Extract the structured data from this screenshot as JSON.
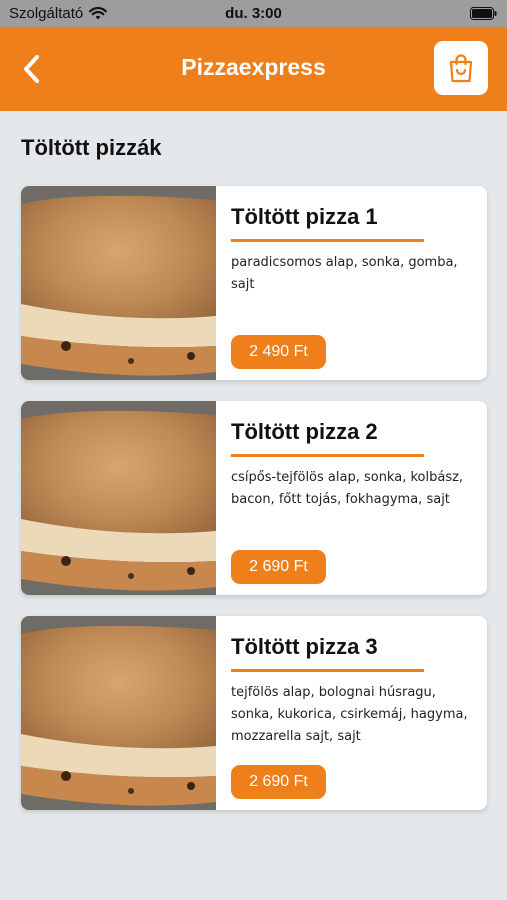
{
  "status_bar": {
    "carrier": "Szolgáltató",
    "time": "du. 3:00"
  },
  "header": {
    "title": "Pizzaexpress",
    "back_icon": "chevron-left-icon",
    "cart_icon": "shopping-bag-icon"
  },
  "section": {
    "title": "Töltött pizzák"
  },
  "products": [
    {
      "name": "Töltött pizza 1",
      "description": "paradicsomos alap, sonka, gomba, sajt",
      "price": "2 490 Ft"
    },
    {
      "name": "Töltött pizza 2",
      "description": "csípős-tejfölös alap, sonka, kolbász, bacon, főtt tojás, fokhagyma, sajt",
      "price": "2 690 Ft"
    },
    {
      "name": "Töltött pizza 3",
      "description": "tejfölös alap, bolognai húsragu, sonka, kukorica, csirkemáj, hagyma, mozzarella sajt, sajt",
      "price": "2 690 Ft"
    }
  ],
  "colors": {
    "accent": "#ef7f1a",
    "background": "#e4e8eb",
    "card": "#ffffff"
  }
}
